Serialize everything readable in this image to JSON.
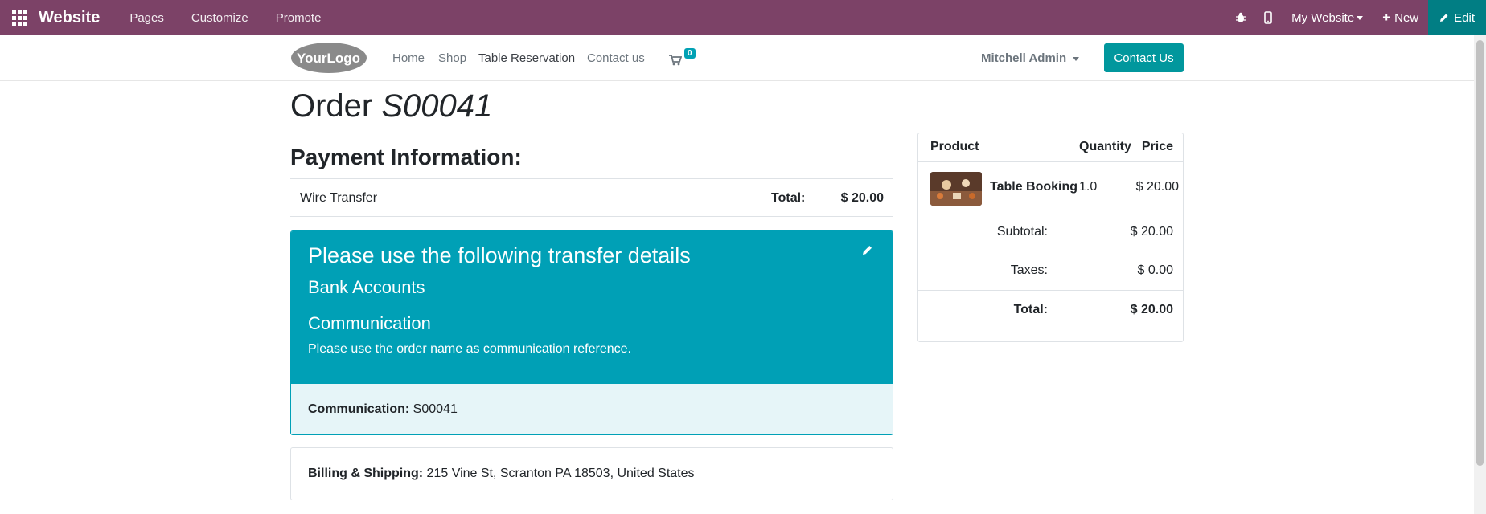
{
  "topbar": {
    "brand": "Website",
    "menus": [
      "Pages",
      "Customize",
      "Promote"
    ],
    "my_website": "My Website",
    "new": "New",
    "edit": "Edit"
  },
  "header": {
    "logo_text": "YourLogo",
    "nav": [
      "Home",
      "Shop",
      "Table Reservation",
      "Contact us"
    ],
    "cart_count": "0",
    "user": "Mitchell Admin",
    "contact_button": "Contact Us"
  },
  "order": {
    "prefix": "Order",
    "number": "S00041"
  },
  "payment": {
    "heading": "Payment Information:",
    "method": "Wire Transfer",
    "total_label": "Total:",
    "total_value": "$ 20.00"
  },
  "transfer": {
    "title": "Please use the following transfer details",
    "bank_accounts": "Bank Accounts",
    "communication_title": "Communication",
    "instruction": "Please use the order name as communication reference.",
    "communication_label": "Communication:",
    "communication_value": "S00041"
  },
  "billing": {
    "label": "Billing & Shipping:",
    "address": "215 Vine St, Scranton PA 18503, United States"
  },
  "summary": {
    "headers": {
      "product": "Product",
      "quantity": "Quantity",
      "price": "Price"
    },
    "product": {
      "name": "Table Booking",
      "qty": "1.0",
      "price": "$ 20.00"
    },
    "subtotal_label": "Subtotal:",
    "subtotal_value": "$ 20.00",
    "taxes_label": "Taxes:",
    "taxes_value": "$ 0.00",
    "total_label": "Total:",
    "total_value": "$ 20.00"
  },
  "colors": {
    "admin_bar": "#7c4267",
    "edit_button": "#017e84",
    "primary": "#01979d",
    "info": "#00a0b6"
  }
}
